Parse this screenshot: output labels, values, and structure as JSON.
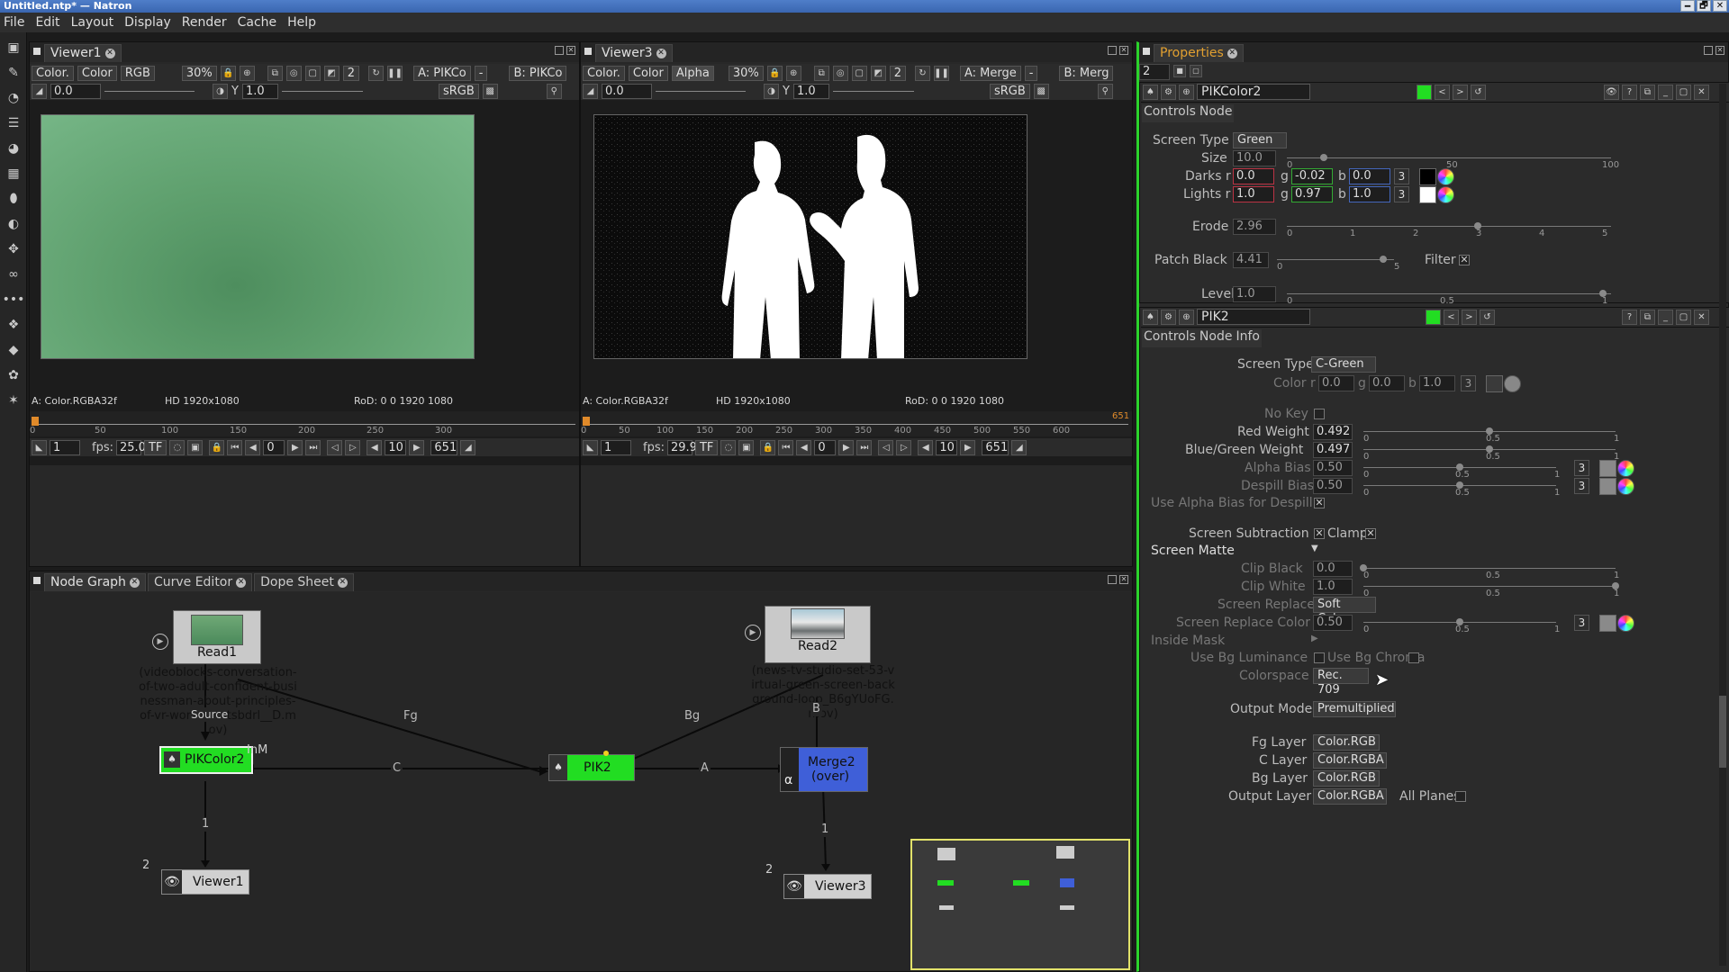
{
  "window": {
    "title": "Untitled.ntp* — Natron",
    "buttons": [
      "🗕",
      "🗗",
      "✕"
    ]
  },
  "menu": [
    "File",
    "Edit",
    "Layout",
    "Display",
    "Render",
    "Cache",
    "Help"
  ],
  "viewer1": {
    "tab": "Viewer1",
    "layer": "Color.",
    "channel_combo": "Color",
    "display": "RGB",
    "zoom": "30%",
    "a_input": "A: PIKCo",
    "a_op": "-",
    "b_input": "B: PIKCo",
    "num2": "2",
    "gain": "0.0",
    "gamma_label": "Y",
    "gamma": "1.0",
    "colorspace": "sRGB",
    "info_left": "A: Color.RGBA32f",
    "info_mid": "HD 1920x1080",
    "info_right": "RoD: 0 0 1920 1080",
    "tl_ticks": [
      "0",
      "50",
      "100",
      "150",
      "200",
      "250",
      "300"
    ],
    "frame": "1",
    "fps_label": "fps:",
    "fps": "25.0",
    "tf": "TF",
    "cur_frame": "0",
    "step": "10",
    "end_frame": "651"
  },
  "viewer3": {
    "tab": "Viewer3",
    "layer": "Color.",
    "channel_combo": "Color",
    "display": "Alpha",
    "zoom": "30%",
    "a_input": "A: Merge",
    "a_op": "-",
    "b_input": "B: Merg",
    "num2": "2",
    "gain": "0.0",
    "gamma_label": "Y",
    "gamma": "1.0",
    "colorspace": "sRGB",
    "info_left": "A: Color.RGBA32f",
    "info_mid": "HD 1920x1080",
    "info_right": "RoD: 0 0 1920 1080",
    "tl_ticks": [
      "0",
      "50",
      "100",
      "150",
      "200",
      "250",
      "300",
      "350",
      "400",
      "450",
      "500",
      "550",
      "600",
      "651"
    ],
    "frame": "1",
    "fps_label": "fps:",
    "fps": "29.9",
    "tf": "TF",
    "cur_frame": "0",
    "step": "10",
    "end_frame": "651"
  },
  "bottom_tabs": [
    "Node Graph",
    "Curve Editor",
    "Dope Sheet"
  ],
  "nodes": {
    "read1": {
      "label": "Read1",
      "file": "(videoblocks-conversation-of-two-adult-confident-businessman-about-principles-of-vr-work_swntsbdrl__D.mov)",
      "source": "Source"
    },
    "read2": {
      "label": "Read2",
      "file": "(news-tv-studio-set-53-virtual-green-screen-background-loop_B6gYUoFG.mov)"
    },
    "pikcolor2": {
      "label": "PIKColor2"
    },
    "pik2": {
      "label": "PIK2"
    },
    "merge2": {
      "label": "Merge2",
      "sub": "(over)",
      "alpha": "α"
    },
    "viewer1": {
      "label": "Viewer1",
      "num": "2"
    },
    "viewer3": {
      "label": "Viewer3",
      "num": "2"
    },
    "edges": {
      "fg": "Fg",
      "bg": "Bg",
      "c": "C",
      "a": "A",
      "b": "B",
      "inm": "InM",
      "one_a": "1",
      "one_b": "1"
    }
  },
  "properties": {
    "tab": "Properties",
    "count": "2",
    "pikcolor": {
      "name": "PIKColor2",
      "tabs": [
        "Controls",
        "Node"
      ],
      "screen_type_label": "Screen Type",
      "screen_type": "Green",
      "size_label": "Size",
      "size": "10.0",
      "size_ticks": [
        "0",
        "50",
        "100"
      ],
      "darks_label": "Darks r",
      "darks_r": "0.0",
      "darks_g": "-0.02",
      "darks_b": "0.0",
      "lights_label": "Lights r",
      "lights_r": "1.0",
      "lights_g": "0.97",
      "lights_b": "1.0",
      "g": "g",
      "b": "b",
      "three": "3",
      "erode_label": "Erode",
      "erode": "2.96",
      "erode_ticks": [
        "0",
        "1",
        "2",
        "3",
        "4",
        "5"
      ],
      "patch_black_label": "Patch Black",
      "patch_black": "4.41",
      "patch_ticks": [
        "0",
        "5"
      ],
      "filter_label": "Filter",
      "level_label": "Level",
      "level": "1.0",
      "level_ticks": [
        "0",
        "0.5",
        "1"
      ]
    },
    "pik": {
      "name": "PIK2",
      "tabs": [
        "Controls",
        "Node",
        "Info"
      ],
      "screen_type_label": "Screen Type",
      "screen_type": "C-Green",
      "color_label": "Color r",
      "color_r": "0.0",
      "color_g": "0.0",
      "color_b": "1.0",
      "g": "g",
      "b": "b",
      "three": "3",
      "no_key_label": "No Key",
      "red_weight_label": "Red Weight",
      "red_weight": "0.492",
      "bg_weight_label": "Blue/Green Weight",
      "bg_weight": "0.497",
      "alpha_bias_label": "Alpha Bias",
      "alpha_bias": "0.50",
      "despill_bias_label": "Despill Bias",
      "despill_bias": "0.50",
      "use_alpha_bias_label": "Use Alpha Bias for Despill",
      "screen_sub_label": "Screen Subtraction",
      "clamp_label": "Clamp",
      "screen_matte_label": "Screen Matte",
      "clip_black_label": "Clip Black",
      "clip_black": "0.0",
      "clip_white_label": "Clip White",
      "clip_white": "1.0",
      "screen_replace_label": "Screen Replace",
      "screen_replace": "Soft Color",
      "screen_replace_color_label": "Screen Replace Color",
      "screen_replace_color": "0.50",
      "inside_mask_label": "Inside Mask",
      "use_bg_lum_label": "Use Bg Luminance",
      "use_bg_chroma_label": "Use Bg Chroma",
      "colorspace_label": "Colorspace",
      "colorspace": "Rec. 709",
      "output_mode_label": "Output Mode",
      "output_mode": "Premultiplied",
      "fg_layer_label": "Fg Layer",
      "fg_layer": "Color.RGB",
      "c_layer_label": "C Layer",
      "c_layer": "Color.RGBA",
      "bg_layer_label": "Bg Layer",
      "bg_layer": "Color.RGB",
      "output_layer_label": "Output Layer",
      "output_layer": "Color.RGBA",
      "all_planes_label": "All Planes",
      "slider_ticks": [
        "0",
        "0.5",
        "1"
      ]
    }
  },
  "colors": {
    "accent_green": "#22dd22",
    "merge_blue": "#3f5fd8",
    "minimap_border": "#e2e26a"
  }
}
